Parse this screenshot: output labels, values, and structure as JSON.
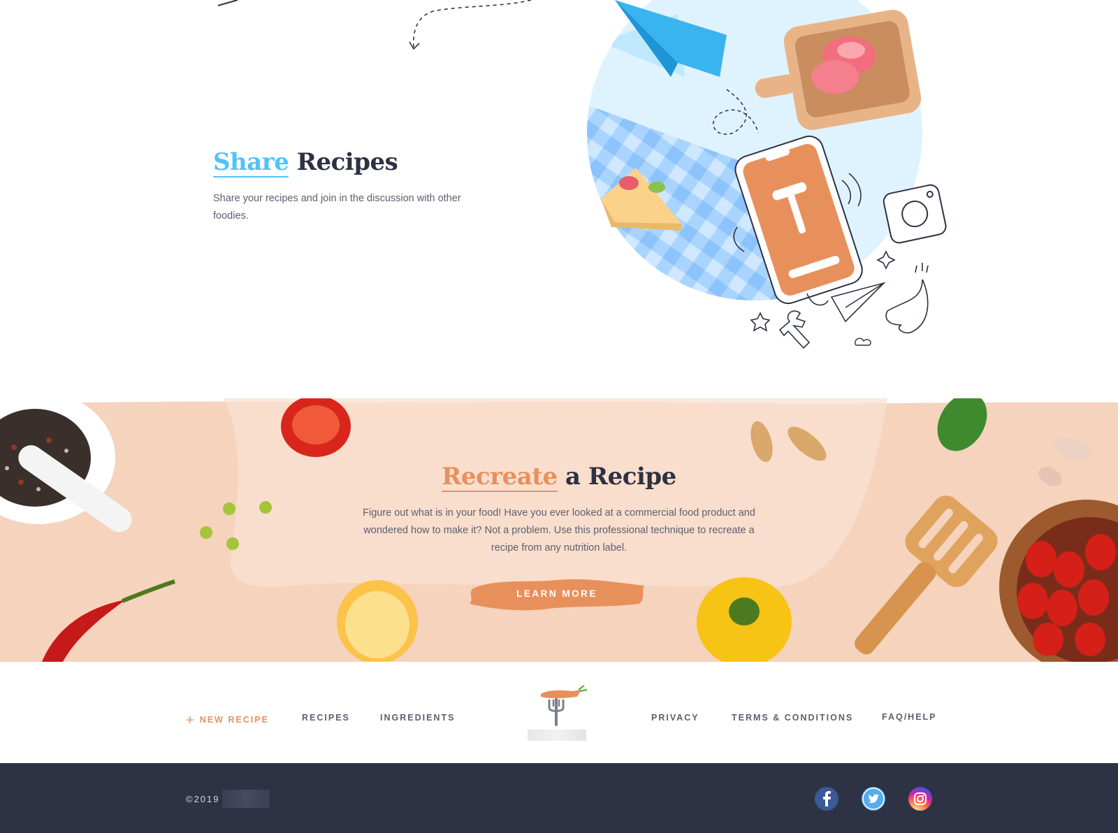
{
  "share": {
    "title_accent": "Share",
    "title_rest": "Recipes",
    "description": "Share your recipes and join in the discussion with other foodies."
  },
  "recreate": {
    "title_accent": "Recreate",
    "title_rest": "a Recipe",
    "description": "Figure out what is in your food! Have you ever looked at a commercial food product and wondered how to make it? Not a problem. Use this professional technique to recreate a recipe from any nutrition label.",
    "button_label": "LEARN MORE"
  },
  "footer": {
    "nav_left": {
      "new_recipe": "NEW RECIPE",
      "recipes": "RECIPES",
      "ingredients": "INGREDIENTS"
    },
    "nav_right": {
      "privacy": "PRIVACY",
      "terms": "TERMS & CONDITIONS",
      "faq": "FAQ/HELP"
    },
    "copyright": "©2019"
  },
  "icons": {
    "plus": "plus-icon",
    "logo": "fork-carrot-logo",
    "facebook": "facebook-icon",
    "twitter": "twitter-icon",
    "instagram": "instagram-icon"
  },
  "colors": {
    "accent_blue": "#4fc3f7",
    "accent_orange": "#e8905c",
    "dark_text": "#2d3142",
    "peach_background": "#f5d3bd",
    "footer_dark": "#2d3345"
  }
}
